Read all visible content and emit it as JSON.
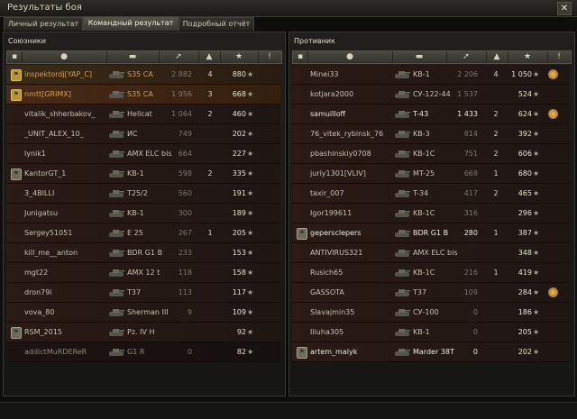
{
  "window": {
    "title": "Результаты боя",
    "close": "✕"
  },
  "tabs": [
    {
      "label": "Личный результат"
    },
    {
      "label": "Командный результат"
    },
    {
      "label": "Подробный отчёт"
    }
  ],
  "allies": {
    "title": "Союзники",
    "rows": [
      {
        "badge": "⚑",
        "name": "inspektordj[YAP_C]",
        "tank": "S35 CA",
        "damage": "2 882",
        "kills": "4",
        "xp": "880",
        "style": "hl"
      },
      {
        "badge": "⚑",
        "name": "nmtt[GRIMX]",
        "tank": "S35 CA",
        "damage": "1 956",
        "kills": "3",
        "xp": "668",
        "style": "self"
      },
      {
        "badge": "",
        "name": "vitalik_shherbakov_",
        "tank": "Hellcat",
        "damage": "1 064",
        "kills": "2",
        "xp": "460",
        "style": ""
      },
      {
        "badge": "",
        "name": "_UNIT_ALEX_10_",
        "tank": "ИС",
        "damage": "749",
        "kills": "",
        "xp": "202",
        "style": ""
      },
      {
        "badge": "",
        "name": "lynik1",
        "tank": "AMX ELC bis",
        "damage": "664",
        "kills": "",
        "xp": "227",
        "style": ""
      },
      {
        "badge": "⚑",
        "name": "KantorGT_1",
        "tank": "KB-1",
        "damage": "598",
        "kills": "2",
        "xp": "335",
        "style": ""
      },
      {
        "badge": "",
        "name": "3_4BILLI",
        "tank": "T25/2",
        "damage": "560",
        "kills": "",
        "xp": "191",
        "style": ""
      },
      {
        "badge": "",
        "name": "Junigatsu",
        "tank": "KB-1",
        "damage": "300",
        "kills": "",
        "xp": "189",
        "style": ""
      },
      {
        "badge": "",
        "name": "Sergey51051",
        "tank": "E 25",
        "damage": "267",
        "kills": "1",
        "xp": "205",
        "style": ""
      },
      {
        "badge": "",
        "name": "kill_me__anton",
        "tank": "BDR G1 B",
        "damage": "233",
        "kills": "",
        "xp": "153",
        "style": ""
      },
      {
        "badge": "",
        "name": "mgt22",
        "tank": "AMX 12 t",
        "damage": "118",
        "kills": "",
        "xp": "158",
        "style": ""
      },
      {
        "badge": "",
        "name": "dron79i",
        "tank": "T37",
        "damage": "113",
        "kills": "",
        "xp": "117",
        "style": ""
      },
      {
        "badge": "",
        "name": "vova_80",
        "tank": "Sherman III",
        "damage": "9",
        "kills": "",
        "xp": "109",
        "style": ""
      },
      {
        "badge": "⚑",
        "name": "RSM_2015",
        "tank": "Pz. IV H",
        "damage": "",
        "kills": "",
        "xp": "92",
        "style": ""
      },
      {
        "badge": "",
        "name": "addictMuRDEReR",
        "tank": "G1 R",
        "damage": "0",
        "kills": "",
        "xp": "82",
        "style": "dead"
      }
    ]
  },
  "enemies": {
    "title": "Противник",
    "rows": [
      {
        "badge": "",
        "name": "Minei33",
        "tank": "KB-1",
        "damage": "2 206",
        "kills": "4",
        "xp": "1 050",
        "medal": true,
        "style": ""
      },
      {
        "badge": "",
        "name": "kotjara2000",
        "tank": "СУ-122-44",
        "damage": "1 537",
        "kills": "",
        "xp": "524",
        "style": ""
      },
      {
        "badge": "",
        "name": "samuilloff",
        "tank": "T-43",
        "damage": "1 433",
        "kills": "2",
        "xp": "624",
        "medal": true,
        "style": "white"
      },
      {
        "badge": "",
        "name": "76_vitek_rybinsk_76",
        "tank": "KB-3",
        "damage": "814",
        "kills": "2",
        "xp": "392",
        "style": ""
      },
      {
        "badge": "",
        "name": "pbashinskiy0708",
        "tank": "KB-1C",
        "damage": "751",
        "kills": "2",
        "xp": "606",
        "style": ""
      },
      {
        "badge": "",
        "name": "juriy1301[VLIV]",
        "tank": "MT-25",
        "damage": "668",
        "kills": "1",
        "xp": "680",
        "style": ""
      },
      {
        "badge": "",
        "name": "taxir_007",
        "tank": "T-34",
        "damage": "417",
        "kills": "2",
        "xp": "465",
        "style": ""
      },
      {
        "badge": "",
        "name": "Igor199611",
        "tank": "KB-1C",
        "damage": "316",
        "kills": "",
        "xp": "296",
        "style": ""
      },
      {
        "badge": "⚑",
        "name": "gepersclepers",
        "tank": "BDR G1 B",
        "damage": "280",
        "kills": "1",
        "xp": "387",
        "style": "white"
      },
      {
        "badge": "",
        "name": "ANTIVIRUS321",
        "tank": "AMX ELC bis",
        "damage": "",
        "kills": "",
        "xp": "348",
        "style": ""
      },
      {
        "badge": "",
        "name": "Rusich65",
        "tank": "KB-1C",
        "damage": "216",
        "kills": "1",
        "xp": "419",
        "style": ""
      },
      {
        "badge": "",
        "name": "GASSOTA",
        "tank": "T37",
        "damage": "109",
        "kills": "",
        "xp": "284",
        "medal": true,
        "style": ""
      },
      {
        "badge": "",
        "name": "Slavajmin35",
        "tank": "СУ-100",
        "damage": "0",
        "kills": "",
        "xp": "186",
        "style": ""
      },
      {
        "badge": "",
        "name": "Iliuha305",
        "tank": "KB-1",
        "damage": "0",
        "kills": "",
        "xp": "205",
        "style": ""
      },
      {
        "badge": "⚑",
        "name": "artem_malyk",
        "tank": "Marder 38T",
        "damage": "0",
        "kills": "",
        "xp": "202",
        "style": "white"
      }
    ]
  },
  "icons": {
    "platoon": "flag-icon",
    "player": "person-icon",
    "tank": "tank-icon",
    "damage": "damage-icon",
    "kills": "kills-icon",
    "xp": "star-icon",
    "status": "exclamation-icon"
  },
  "colors": {
    "accent_gold": "#d2a14a",
    "row_ally": "#2b1a16",
    "row_enemy": "#2b1a16"
  }
}
